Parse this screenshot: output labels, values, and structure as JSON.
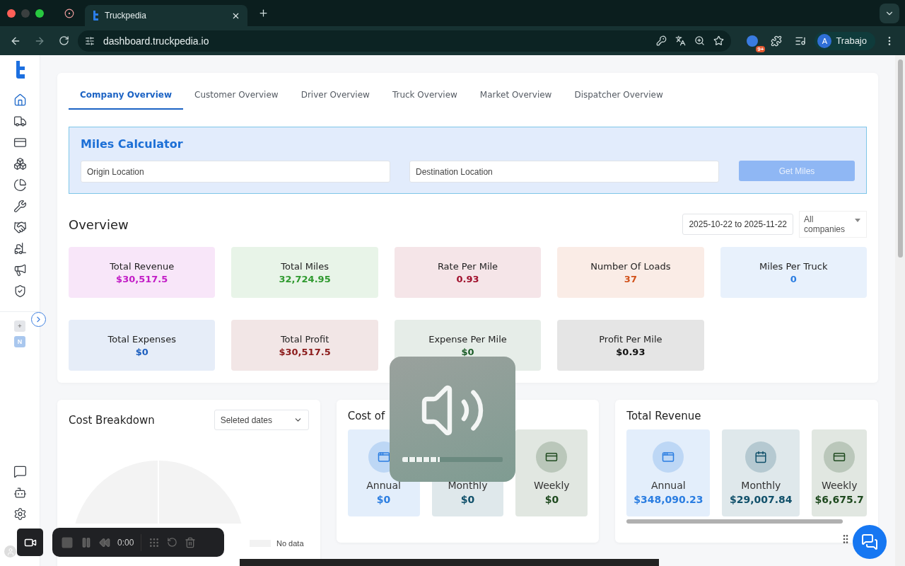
{
  "browser": {
    "tab_title": "Truckpedia",
    "url": "dashboard.truckpedia.io",
    "extension_badge": "9+",
    "profile": {
      "initial": "A",
      "name": "Trabajo"
    }
  },
  "sidebar": {
    "items": [
      {
        "selected": true
      },
      {
        "selected": false
      },
      {
        "selected": false
      },
      {
        "selected": false
      },
      {
        "selected": false
      },
      {
        "selected": false
      },
      {
        "selected": false
      },
      {
        "selected": false
      },
      {
        "selected": false
      },
      {
        "selected": false
      }
    ],
    "badges": [
      "+",
      "N"
    ],
    "bottom_items": [
      {
        "selected": false
      },
      {
        "selected": false
      },
      {
        "selected": false
      }
    ]
  },
  "tabs": [
    {
      "label": "Company Overview",
      "selected": true
    },
    {
      "label": "Customer Overview",
      "selected": false
    },
    {
      "label": "Driver Overview",
      "selected": false
    },
    {
      "label": "Truck Overview",
      "selected": false
    },
    {
      "label": "Market Overview",
      "selected": false
    },
    {
      "label": "Dispatcher Overview",
      "selected": false
    }
  ],
  "miles_calculator": {
    "title": "Miles Calculator",
    "origin": {
      "placeholder": "Origin Location"
    },
    "destination": {
      "placeholder": "Destination Location"
    },
    "button": {
      "label": "Get Miles",
      "disabled": true
    }
  },
  "overview": {
    "title": "Overview",
    "date_range": "2025-10-22 to 2025-11-22",
    "company_filter": "All companies",
    "cards": [
      {
        "label": "Total Revenue",
        "value": "$30,517.5",
        "color": "#c21bc6"
      },
      {
        "label": "Total Miles",
        "value": "32,724.95",
        "color": "#2f9a2f"
      },
      {
        "label": "Rate Per Mile",
        "value": "0.93",
        "color": "#a0102c"
      },
      {
        "label": "Number Of Loads",
        "value": "37",
        "color": "#d2521b"
      },
      {
        "label": "Miles Per Truck",
        "value": "0",
        "color": "#2a7de1"
      },
      {
        "label": "Total Expenses",
        "value": "$0",
        "color": "#1d5fbf"
      },
      {
        "label": "Total Profit",
        "value": "$30,517.5",
        "color": "#8b1a1a"
      },
      {
        "label": "Expense Per Mile",
        "value": "$0",
        "color": "#1e5e2a"
      },
      {
        "label": "Profit Per Mile",
        "value": "$0.93",
        "color": "#111111"
      }
    ]
  },
  "cost_breakdown": {
    "title": "Cost Breakdown",
    "period_select": "Seleted dates",
    "legend": [
      "No data"
    ]
  },
  "cost_of": {
    "title": "Cost of",
    "items": [
      {
        "period": "Annual",
        "value": "$0",
        "color": "#2a7de1"
      },
      {
        "period": "Monthly",
        "value": "$0",
        "color": "#10506a"
      },
      {
        "period": "Weekly",
        "value": "$0",
        "color": "#1f4a1f"
      }
    ]
  },
  "total_revenue": {
    "title": "Total Revenue",
    "items": [
      {
        "period": "Annual",
        "value": "$348,090.23",
        "color": "#2a7de1"
      },
      {
        "period": "Monthly",
        "value": "$29,007.84",
        "color": "#10506a"
      },
      {
        "period": "Weekly",
        "value": "$6,675.7",
        "color": "#1f4a1f"
      }
    ]
  },
  "volume_hud": {
    "level": 0.37
  },
  "recorder": {
    "time": "0:00"
  }
}
